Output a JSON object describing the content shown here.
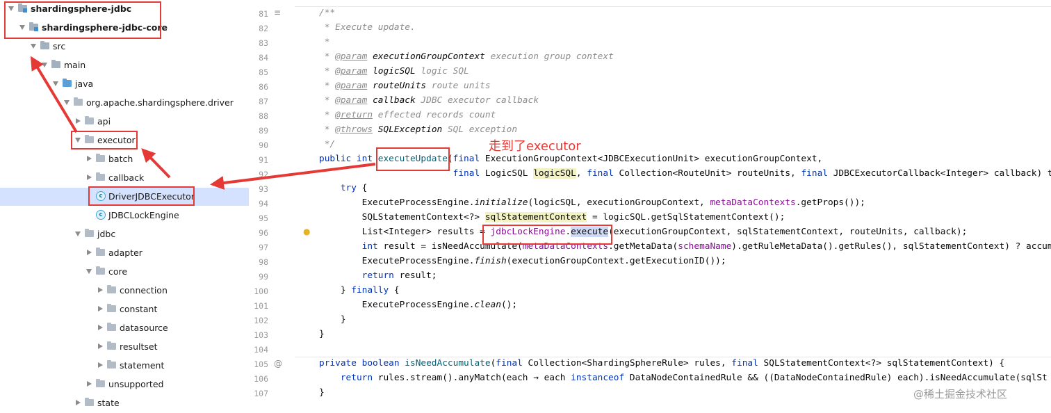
{
  "project_tree": {
    "nodes": [
      {
        "label": "shardingsphere-jdbc",
        "type": "module",
        "expanded": true,
        "bold": true
      },
      {
        "label": "shardingsphere-jdbc-core",
        "type": "module",
        "expanded": true,
        "bold": true
      },
      {
        "label": "src",
        "type": "folder",
        "expanded": true
      },
      {
        "label": "main",
        "type": "folder",
        "expanded": true
      },
      {
        "label": "java",
        "type": "source-root",
        "expanded": true
      },
      {
        "label": "org.apache.shardingsphere.driver",
        "type": "package",
        "expanded": true
      },
      {
        "label": "api",
        "type": "package",
        "expanded": false
      },
      {
        "label": "executor",
        "type": "package",
        "expanded": true
      },
      {
        "label": "batch",
        "type": "package",
        "expanded": false
      },
      {
        "label": "callback",
        "type": "package",
        "expanded": false
      },
      {
        "label": "DriverJDBCExecutor",
        "type": "class",
        "selected": true
      },
      {
        "label": "JDBCLockEngine",
        "type": "class"
      },
      {
        "label": "jdbc",
        "type": "package",
        "expanded": true
      },
      {
        "label": "adapter",
        "type": "package",
        "expanded": false
      },
      {
        "label": "core",
        "type": "package",
        "expanded": true
      },
      {
        "label": "connection",
        "type": "package",
        "expanded": false
      },
      {
        "label": "constant",
        "type": "package",
        "expanded": false
      },
      {
        "label": "datasource",
        "type": "package",
        "expanded": false
      },
      {
        "label": "resultset",
        "type": "package",
        "expanded": false
      },
      {
        "label": "statement",
        "type": "package",
        "expanded": false
      },
      {
        "label": "unsupported",
        "type": "package",
        "expanded": false
      },
      {
        "label": "state",
        "type": "package",
        "expanded": false
      }
    ]
  },
  "editor": {
    "line_numbers": [
      "81",
      "82",
      "83",
      "84",
      "85",
      "86",
      "87",
      "88",
      "89",
      "90",
      "91",
      "92",
      "93",
      "94",
      "95",
      "96",
      "97",
      "98",
      "99",
      "100",
      "101",
      "102",
      "103",
      "104",
      "105",
      "106",
      "107"
    ],
    "lines": [
      {
        "parts": [
          [
            "cm",
            "/**"
          ]
        ]
      },
      {
        "parts": [
          [
            "cm",
            " * Execute update."
          ]
        ]
      },
      {
        "parts": [
          [
            "cm",
            " *"
          ]
        ]
      },
      {
        "parts": [
          [
            "cm",
            " * "
          ],
          [
            "tag",
            "@param"
          ],
          [
            "cm",
            " "
          ],
          [
            "pn",
            "executionGroupContext"
          ],
          [
            "cm",
            " execution group context"
          ]
        ]
      },
      {
        "parts": [
          [
            "cm",
            " * "
          ],
          [
            "tag",
            "@param"
          ],
          [
            "cm",
            " "
          ],
          [
            "pn",
            "logicSQL"
          ],
          [
            "cm",
            " logic SQL"
          ]
        ]
      },
      {
        "parts": [
          [
            "cm",
            " * "
          ],
          [
            "tag",
            "@param"
          ],
          [
            "cm",
            " "
          ],
          [
            "pn",
            "routeUnits"
          ],
          [
            "cm",
            " route units"
          ]
        ]
      },
      {
        "parts": [
          [
            "cm",
            " * "
          ],
          [
            "tag",
            "@param"
          ],
          [
            "cm",
            " "
          ],
          [
            "pn",
            "callback"
          ],
          [
            "cm",
            " JDBC executor callback"
          ]
        ]
      },
      {
        "parts": [
          [
            "cm",
            " * "
          ],
          [
            "tag",
            "@return"
          ],
          [
            "cm",
            " effected records count"
          ]
        ]
      },
      {
        "parts": [
          [
            "cm",
            " * "
          ],
          [
            "tag",
            "@throws"
          ],
          [
            "cm",
            " "
          ],
          [
            "pn",
            "SQLException"
          ],
          [
            "cm",
            " SQL exception"
          ]
        ]
      },
      {
        "parts": [
          [
            "cm",
            " */"
          ]
        ]
      },
      {
        "parts": [
          [
            "kw",
            "public int "
          ],
          [
            "mth",
            "executeUpdate"
          ],
          [
            "",
            "("
          ],
          [
            "kw",
            "final "
          ],
          [
            "",
            "ExecutionGroupContext<JDBCExecutionUnit> executionGroupContext,"
          ]
        ]
      },
      {
        "parts": [
          [
            "",
            "                         "
          ],
          [
            "kw",
            "final "
          ],
          [
            "",
            "LogicSQL "
          ],
          [
            "hl",
            "logicSQL"
          ],
          [
            "",
            ", "
          ],
          [
            "kw",
            "final "
          ],
          [
            "",
            "Collection<RouteUnit> routeUnits, "
          ],
          [
            "kw",
            "final "
          ],
          [
            "",
            "JDBCExecutorCallback<Integer> callback) t"
          ]
        ]
      },
      {
        "parts": [
          [
            "",
            "    "
          ],
          [
            "kw",
            "try "
          ],
          [
            "",
            "{"
          ]
        ]
      },
      {
        "parts": [
          [
            "",
            "        ExecuteProcessEngine."
          ],
          [
            "st",
            "initialize"
          ],
          [
            "",
            "(logicSQL, executionGroupContext, "
          ],
          [
            "fld",
            "metaDataContexts"
          ],
          [
            "",
            ".getProps());"
          ]
        ]
      },
      {
        "parts": [
          [
            "",
            "        SQLStatementContext<?> "
          ],
          [
            "hl",
            "sqlStatementContext"
          ],
          [
            "",
            " = logicSQL.getSqlStatementContext();"
          ]
        ]
      },
      {
        "parts": [
          [
            "",
            "        List<Integer> results = "
          ],
          [
            "fld",
            "jdbcLockEngine"
          ],
          [
            "",
            "."
          ],
          [
            "sel",
            "execute"
          ],
          [
            "",
            "(executionGroupContext, sqlStatementContext, routeUnits, callback);"
          ]
        ]
      },
      {
        "parts": [
          [
            "",
            "        "
          ],
          [
            "kw",
            "int "
          ],
          [
            "",
            "result = isNeedAccumulate("
          ],
          [
            "fld",
            "metaDataContexts"
          ],
          [
            "",
            ".getMetaData("
          ],
          [
            "fld",
            "schemaName"
          ],
          [
            "",
            ").getRuleMetaData().getRules(), sqlStatementContext) ? accum"
          ]
        ]
      },
      {
        "parts": [
          [
            "",
            "        ExecuteProcessEngine."
          ],
          [
            "st",
            "finish"
          ],
          [
            "",
            "(executionGroupContext.getExecutionID());"
          ]
        ]
      },
      {
        "parts": [
          [
            "",
            "        "
          ],
          [
            "kw",
            "return "
          ],
          [
            "",
            "result;"
          ]
        ]
      },
      {
        "parts": [
          [
            "",
            "    } "
          ],
          [
            "kw",
            "finally "
          ],
          [
            "",
            "{"
          ]
        ]
      },
      {
        "parts": [
          [
            "",
            "        ExecuteProcessEngine."
          ],
          [
            "st",
            "clean"
          ],
          [
            "",
            "();"
          ]
        ]
      },
      {
        "parts": [
          [
            "",
            "    }"
          ]
        ]
      },
      {
        "parts": [
          [
            "",
            "}"
          ]
        ]
      },
      {
        "parts": [
          [
            "",
            ""
          ]
        ]
      },
      {
        "parts": [
          [
            "kw",
            "private boolean "
          ],
          [
            "mth",
            "isNeedAccumulate"
          ],
          [
            "",
            "("
          ],
          [
            "kw",
            "final "
          ],
          [
            "",
            "Collection<ShardingSphereRule> rules, "
          ],
          [
            "kw",
            "final "
          ],
          [
            "",
            "SQLStatementContext<?> sqlStatementContext) {"
          ]
        ]
      },
      {
        "parts": [
          [
            "",
            "    "
          ],
          [
            "kw",
            "return "
          ],
          [
            "",
            "rules.stream().anyMatch(each → each "
          ],
          [
            "kw",
            "instanceof "
          ],
          [
            "",
            "DataNodeContainedRule && ((DataNodeContainedRule) each).isNeedAccumulate(sqlSt"
          ]
        ]
      },
      {
        "parts": [
          [
            "",
            "}"
          ]
        ]
      }
    ]
  },
  "annotation": {
    "text": "走到了executor",
    "color": "#e53935"
  },
  "watermark": {
    "text": "@稀土掘金技术社区"
  },
  "colors": {
    "highlight_red": "#e53935",
    "selection": "#d4e2ff",
    "keyword": "#0033b3",
    "comment": "#8c8c8c",
    "field": "#871094",
    "method": "#00627a"
  }
}
